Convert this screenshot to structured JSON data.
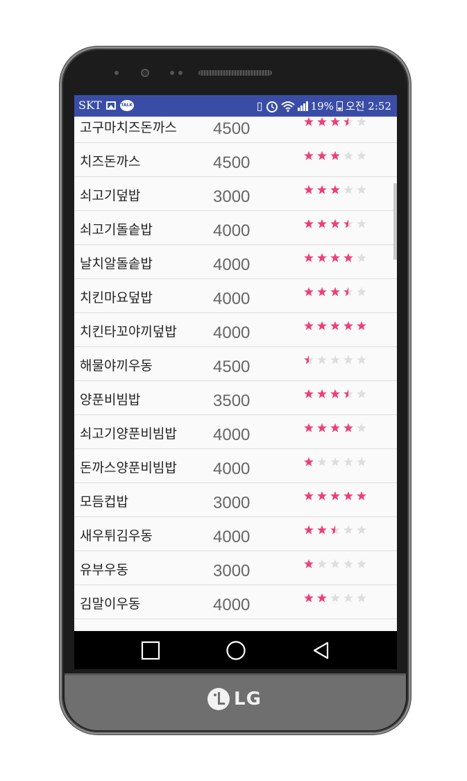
{
  "status_bar": {
    "carrier": "SKT",
    "battery_percent": "19%",
    "time": "오전 2:52",
    "background": "#3a4da6",
    "icons": [
      "image-icon",
      "kakaotalk-icon",
      "vibrate-icon",
      "alarm-icon",
      "wifi-icon",
      "signal-icon",
      "battery-icon"
    ],
    "talk_label": "TALK"
  },
  "menu": {
    "star_color_on": "#ee3f7a",
    "star_color_off": "#dedede",
    "items": [
      {
        "name": "고구마치즈돈까스",
        "price": "4500",
        "rating": 3.5
      },
      {
        "name": "치즈돈까스",
        "price": "4500",
        "rating": 3
      },
      {
        "name": "쇠고기덮밥",
        "price": "3000",
        "rating": 3
      },
      {
        "name": "쇠고기돌솥밥",
        "price": "4000",
        "rating": 3.5
      },
      {
        "name": "날치알돌솥밥",
        "price": "4000",
        "rating": 4
      },
      {
        "name": "치킨마요덮밥",
        "price": "4000",
        "rating": 3.5
      },
      {
        "name": "치킨타꼬야끼덮밥",
        "price": "4000",
        "rating": 5
      },
      {
        "name": "해물야끼우동",
        "price": "4500",
        "rating": 0.5
      },
      {
        "name": "양푼비빔밥",
        "price": "3500",
        "rating": 3.5
      },
      {
        "name": "쇠고기양푼비빔밥",
        "price": "4000",
        "rating": 4
      },
      {
        "name": "돈까스양푼비빔밥",
        "price": "4000",
        "rating": 1
      },
      {
        "name": "모듬컵밥",
        "price": "3000",
        "rating": 5
      },
      {
        "name": "새우튀김우동",
        "price": "4000",
        "rating": 2.5
      },
      {
        "name": "유부우동",
        "price": "3000",
        "rating": 1
      },
      {
        "name": "김말이우동",
        "price": "4000",
        "rating": 2
      }
    ]
  },
  "nav_bar": {
    "buttons": [
      "recent-apps",
      "home",
      "back"
    ]
  },
  "device": {
    "brand": "LG"
  }
}
